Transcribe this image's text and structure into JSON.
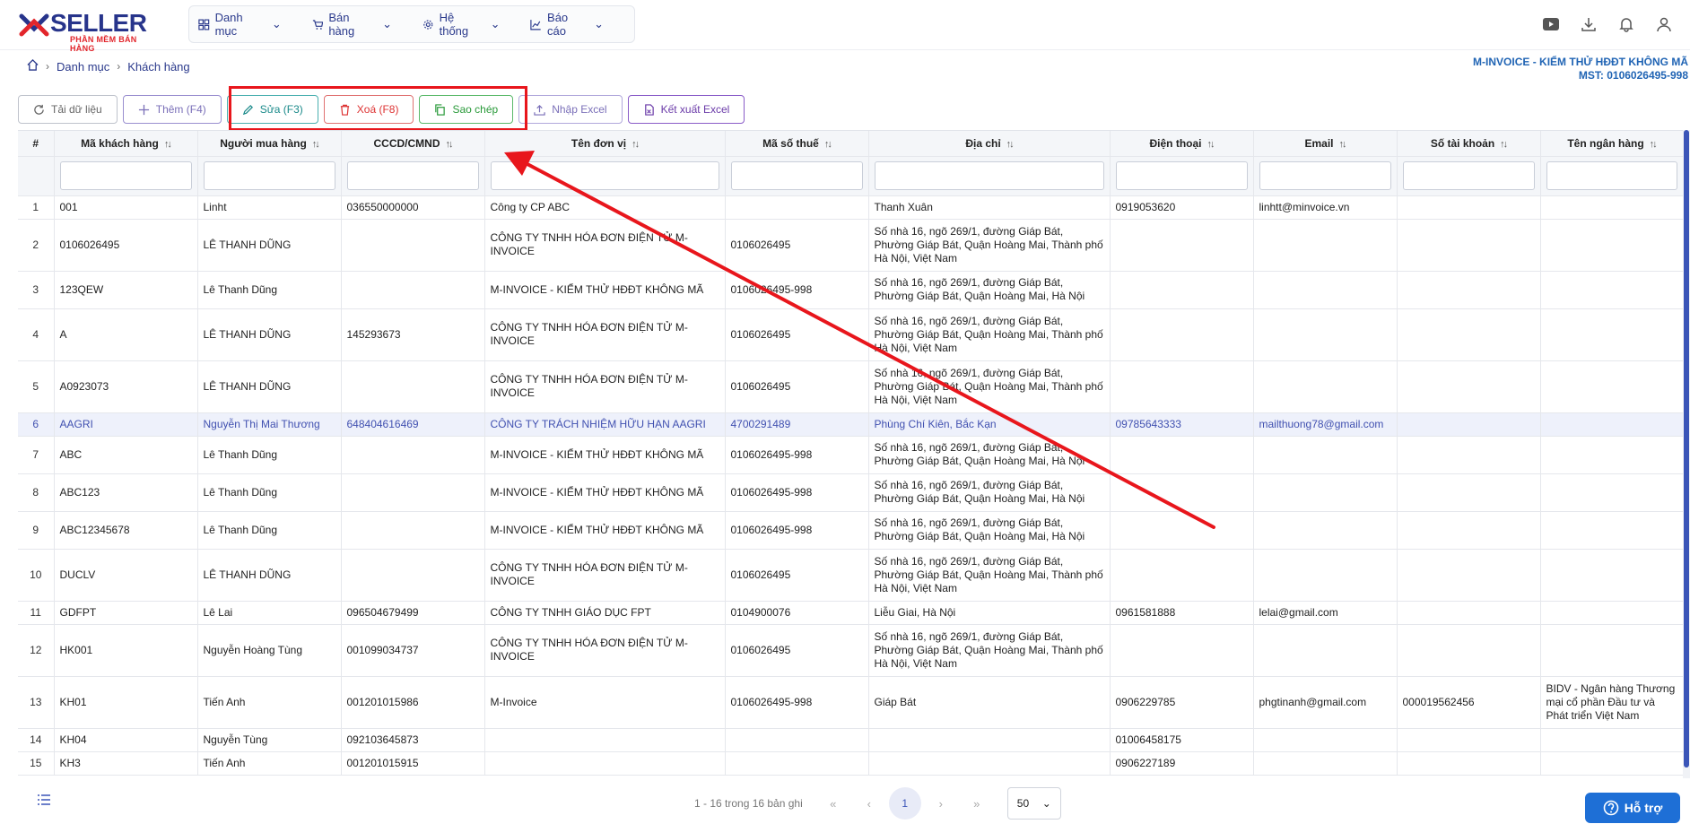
{
  "header": {
    "logo_text": "SELLER",
    "logo_sub": "PHẦN MỀM BÁN HÀNG",
    "nav": [
      {
        "label": "Danh mục",
        "icon": "grid-icon"
      },
      {
        "label": "Bán hàng",
        "icon": "cart-icon"
      },
      {
        "label": "Hệ thống",
        "icon": "gear-icon"
      },
      {
        "label": "Báo cáo",
        "icon": "chart-icon"
      }
    ]
  },
  "breadcrumb": {
    "items": [
      "Danh mục",
      "Khách hàng"
    ]
  },
  "company": {
    "name": "M-INVOICE - KIỂM THỬ HĐĐT KHÔNG MÃ",
    "tax": "MST: 0106026495-998"
  },
  "toolbar": {
    "refresh": "Tải dữ liệu",
    "add": "Thêm (F4)",
    "edit": "Sửa (F3)",
    "delete": "Xoá (F8)",
    "copy": "Sao chép",
    "import": "Nhập Excel",
    "export": "Kết xuất Excel"
  },
  "table": {
    "columns": [
      "#",
      "Mã khách hàng",
      "Người mua hàng",
      "CCCD/CMND",
      "Tên đơn vị",
      "Mã số thuế",
      "Địa chỉ",
      "Điện thoại",
      "Email",
      "Số tài khoản",
      "Tên ngân hàng"
    ],
    "rows": [
      [
        "1",
        "001",
        "Linht",
        "036550000000",
        "Công ty CP ABC",
        "",
        "Thanh Xuân",
        "0919053620",
        "linhtt@minvoice.vn",
        "",
        ""
      ],
      [
        "2",
        "0106026495",
        "LÊ THANH DŨNG",
        "",
        "CÔNG TY TNHH HÓA ĐƠN ĐIỆN TỬ M-INVOICE",
        "0106026495",
        "Số nhà 16, ngõ 269/1, đường Giáp Bát, Phường Giáp Bát, Quận Hoàng Mai, Thành phố Hà Nội, Việt Nam",
        "",
        "",
        "",
        ""
      ],
      [
        "3",
        "123QEW",
        "Lê Thanh Dũng",
        "",
        "M-INVOICE - KIỂM THỬ HĐĐT KHÔNG MÃ",
        "0106026495-998",
        "Số nhà 16, ngõ 269/1, đường Giáp Bát, Phường Giáp Bát, Quận Hoàng Mai, Hà Nội",
        "",
        "",
        "",
        ""
      ],
      [
        "4",
        "A",
        "LÊ THANH DŨNG",
        "145293673",
        "CÔNG TY TNHH HÓA ĐƠN ĐIỆN TỬ M-INVOICE",
        "0106026495",
        "Số nhà 16, ngõ 269/1, đường Giáp Bát, Phường Giáp Bát, Quận Hoàng Mai, Thành phố Hà Nội, Việt Nam",
        "",
        "",
        "",
        ""
      ],
      [
        "5",
        "A0923073",
        "LÊ THANH DŨNG",
        "",
        "CÔNG TY TNHH HÓA ĐƠN ĐIỆN TỬ M-INVOICE",
        "0106026495",
        "Số nhà 16, ngõ 269/1, đường Giáp Bát, Phường Giáp Bát, Quận Hoàng Mai, Thành phố Hà Nội, Việt Nam",
        "",
        "",
        "",
        ""
      ],
      [
        "6",
        "AAGRI",
        "Nguyễn Thị Mai Thương",
        "648404616469",
        "CÔNG TY TRÁCH NHIỆM HỮU HẠN AAGRI",
        "4700291489",
        "Phùng Chí Kiên, Bắc Kạn",
        "09785643333",
        "mailthuong78@gmail.com",
        "",
        ""
      ],
      [
        "7",
        "ABC",
        "Lê Thanh Dũng",
        "",
        "M-INVOICE - KIỂM THỬ HĐĐT KHÔNG MÃ",
        "0106026495-998",
        "Số nhà 16, ngõ 269/1, đường Giáp Bát, Phường Giáp Bát, Quận Hoàng Mai, Hà Nội",
        "",
        "",
        "",
        ""
      ],
      [
        "8",
        "ABC123",
        "Lê Thanh Dũng",
        "",
        "M-INVOICE - KIỂM THỬ HĐĐT KHÔNG MÃ",
        "0106026495-998",
        "Số nhà 16, ngõ 269/1, đường Giáp Bát, Phường Giáp Bát, Quận Hoàng Mai, Hà Nội",
        "",
        "",
        "",
        ""
      ],
      [
        "9",
        "ABC12345678",
        "Lê Thanh Dũng",
        "",
        "M-INVOICE - KIỂM THỬ HĐĐT KHÔNG MÃ",
        "0106026495-998",
        "Số nhà 16, ngõ 269/1, đường Giáp Bát, Phường Giáp Bát, Quận Hoàng Mai, Hà Nội",
        "",
        "",
        "",
        ""
      ],
      [
        "10",
        "DUCLV",
        "LÊ THANH DŨNG",
        "",
        "CÔNG TY TNHH HÓA ĐƠN ĐIỆN TỬ M-INVOICE",
        "0106026495",
        "Số nhà 16, ngõ 269/1, đường Giáp Bát, Phường Giáp Bát, Quận Hoàng Mai, Thành phố Hà Nội, Việt Nam",
        "",
        "",
        "",
        ""
      ],
      [
        "11",
        "GDFPT",
        "Lê Lai",
        "096504679499",
        "CÔNG TY TNHH GIÁO DỤC FPT",
        "0104900076",
        "Liễu Giai, Hà Nội",
        "0961581888",
        "lelai@gmail.com",
        "",
        ""
      ],
      [
        "12",
        "HK001",
        "Nguyễn Hoàng Tùng",
        "001099034737",
        "CÔNG TY TNHH HÓA ĐƠN ĐIỆN TỬ M-INVOICE",
        "0106026495",
        "Số nhà 16, ngõ 269/1, đường Giáp Bát, Phường Giáp Bát, Quận Hoàng Mai, Thành phố Hà Nội, Việt Nam",
        "",
        "",
        "",
        ""
      ],
      [
        "13",
        "KH01",
        "Tiến Anh",
        "001201015986",
        "M-Invoice",
        "0106026495-998",
        "Giáp Bát",
        "0906229785",
        "phgtinanh@gmail.com",
        "000019562456",
        "BIDV - Ngân hàng Thương mại cổ phần Đầu tư và Phát triển Việt Nam"
      ],
      [
        "14",
        "KH04",
        "Nguyễn Tùng",
        "092103645873",
        "",
        "",
        "",
        "01006458175",
        "",
        "",
        ""
      ],
      [
        "15",
        "KH3",
        "Tiến Anh",
        "001201015915",
        "",
        "",
        "",
        "0906227189",
        "",
        "",
        ""
      ]
    ]
  },
  "footer": {
    "info": "1 - 16 trong 16 bản ghi",
    "page": "1",
    "page_size": "50",
    "help": "Hỗ trợ"
  },
  "colors": {
    "accent": "#3b55b8",
    "highlight": "#e8161c"
  }
}
